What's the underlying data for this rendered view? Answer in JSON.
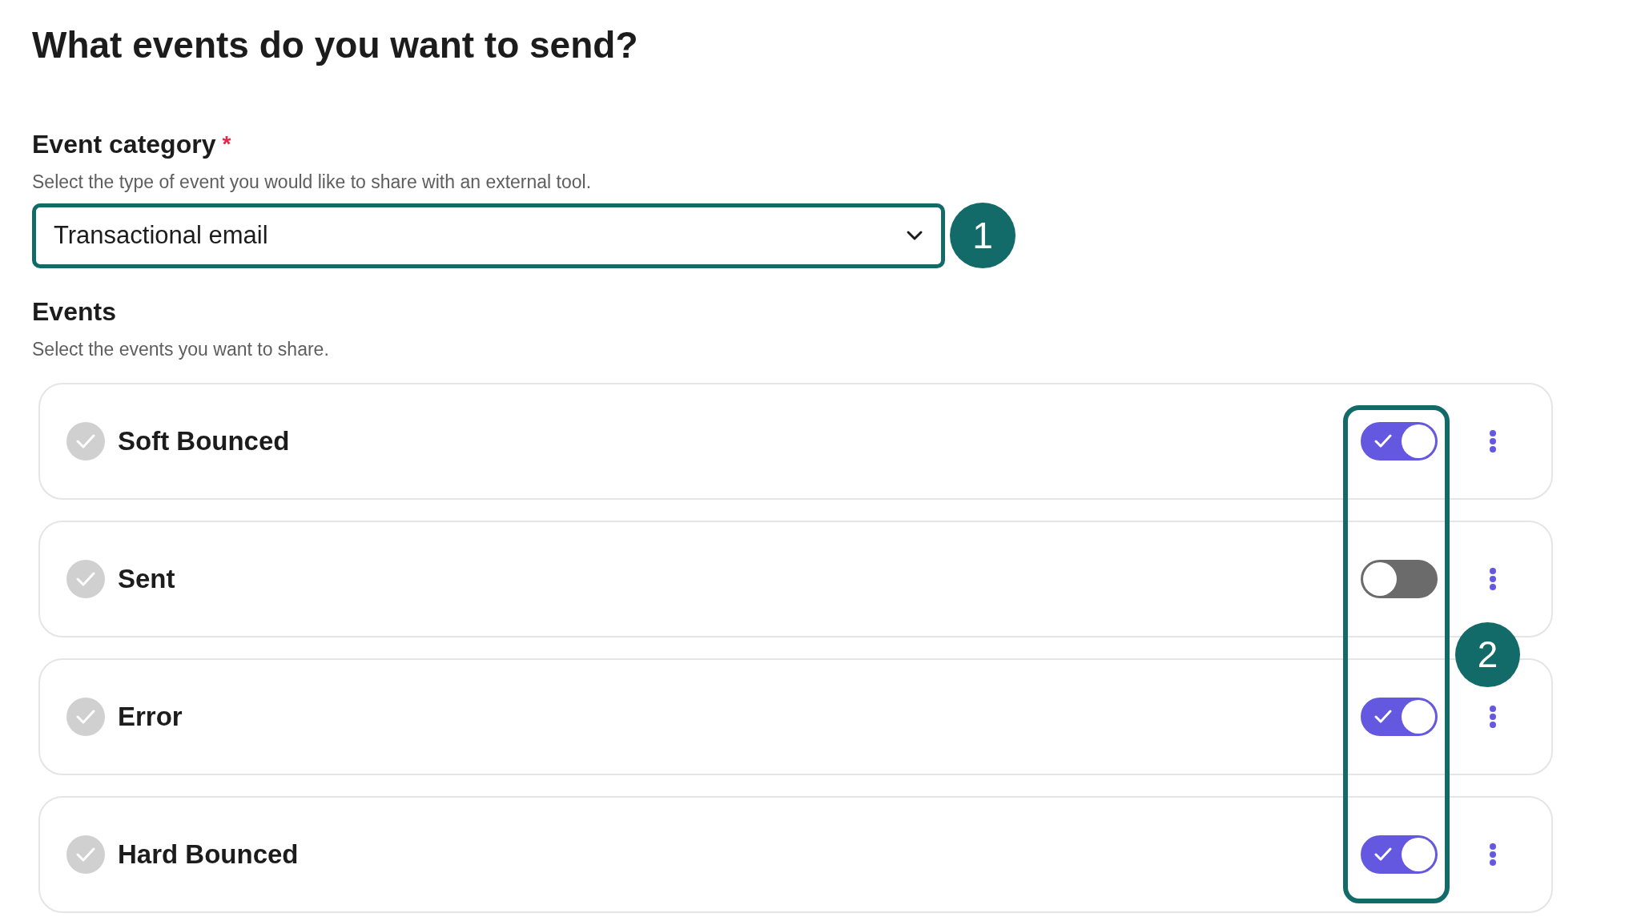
{
  "title": "What events do you want to send?",
  "category": {
    "label": "Event category",
    "required_mark": "*",
    "description": "Select the type of event you would like to share with an external tool.",
    "value": "Transactional email"
  },
  "events": {
    "heading": "Events",
    "description": "Select the events you want to share.",
    "items": [
      {
        "name": "Soft Bounced",
        "on": true
      },
      {
        "name": "Sent",
        "on": false
      },
      {
        "name": "Error",
        "on": true
      },
      {
        "name": "Hard Bounced",
        "on": true
      }
    ]
  },
  "annotations": [
    "1",
    "2"
  ]
}
